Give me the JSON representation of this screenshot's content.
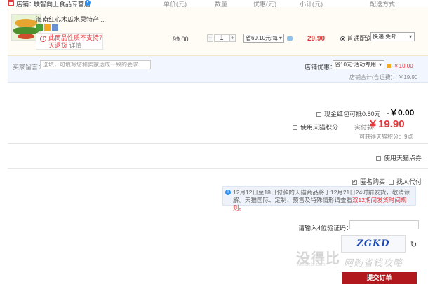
{
  "header": {
    "store_label": "店铺：",
    "store_name": "联智向上食品专营店",
    "col_price": "单价(元)",
    "col_qty": "数量",
    "col_discount": "优惠(元)",
    "col_subtotal": "小计(元)",
    "col_shipping": "配送方式"
  },
  "item": {
    "title": "海南红心木瓜水果特产 ...",
    "warning": "此商品性质不支持7天退货",
    "warning_link": "详情",
    "price": "99.00",
    "quantity": "1",
    "discount_option": "省69.10元:每",
    "subtotal": "29.90",
    "shipping_option": "普通配送",
    "shipping_select": "快递 免邮"
  },
  "message": {
    "label": "买家留言：",
    "placeholder": "选填，可填写您和卖家达成一致的要求",
    "store_discount_label": "店铺优惠：",
    "store_discount_select": "省10元:活动专用",
    "store_discount_value": "-￥10.00",
    "store_total": "店铺合计(含运费)：￥19.90"
  },
  "summary": {
    "redpack_label": "现金红包可抵0.80元",
    "redpack_amount": "-￥0.00",
    "tmall_points_label": "使用天猫积分",
    "pay_label": "实付款：",
    "pay_amount": "￥19.90",
    "earn_points": "可获得天猫积分：9点",
    "tmall_points_coupon": "使用天猫点券",
    "anonymous": "匿名购买",
    "proxy_pay": "找人代付"
  },
  "notice": {
    "text": "12月12日至18日付款的天猫商品将于12月21日24时前发货，敬请谅解。天猫国际、定制、预售及特殊情形请查看",
    "link": "双12期间发货时间规则。"
  },
  "captcha": {
    "label": "请输入4位验证码：",
    "required_mark": "*",
    "code_text": "ZGKD",
    "submit": "提交订单"
  },
  "watermark": {
    "main": "没得比",
    "sub": "Meidebi.com",
    "tag": "网购省钱攻略"
  }
}
